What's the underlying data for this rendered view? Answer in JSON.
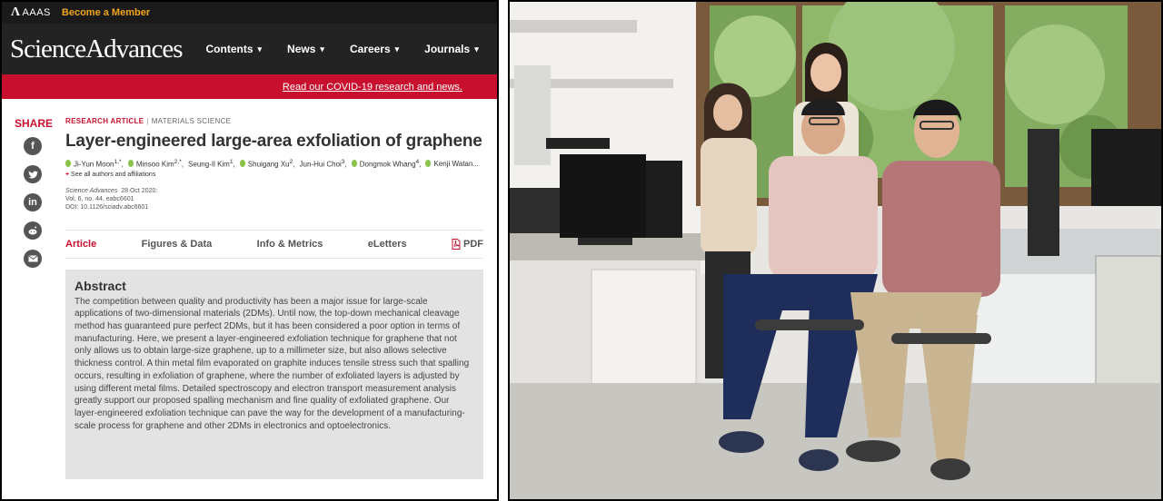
{
  "topbar": {
    "org": "AAAS",
    "become_member": "Become a Member"
  },
  "nav": {
    "brand": "ScienceAdvances",
    "items": [
      {
        "label": "Contents"
      },
      {
        "label": "News"
      },
      {
        "label": "Careers"
      },
      {
        "label": "Journals"
      }
    ]
  },
  "banner": {
    "covid_link": "Read our COVID-19 research and news."
  },
  "share": {
    "label": "SHARE",
    "icons": [
      "facebook-icon",
      "twitter-icon",
      "linkedin-icon",
      "reddit-icon",
      "email-icon"
    ]
  },
  "article": {
    "type": "RESEARCH ARTICLE",
    "subject": "MATERIALS SCIENCE",
    "title": "Layer-engineered large-area exfoliation of graphene",
    "authors": [
      {
        "name": "Ji-Yun Moon",
        "sup": "1,*"
      },
      {
        "name": "Minsoo Kim",
        "sup": "2,*"
      },
      {
        "name": "Seung-Il Kim",
        "sup": "1"
      },
      {
        "name": "Shuigang Xu",
        "sup": "2"
      },
      {
        "name": "Jun-Hui Choi",
        "sup": "3"
      },
      {
        "name": "Dongmok Whang",
        "sup": "4"
      },
      {
        "name": "Kenji Watan...",
        "sup": ""
      }
    ],
    "see_all": "See all authors and affiliations",
    "journal": "Science Advances",
    "date": "28 Oct 2020:",
    "volume": "Vol. 6, no. 44, eabc6601",
    "doi": "DOI: 10.1126/sciadv.abc6601"
  },
  "tabs": [
    {
      "label": "Article",
      "active": true
    },
    {
      "label": "Figures & Data",
      "active": false
    },
    {
      "label": "Info & Metrics",
      "active": false
    },
    {
      "label": "eLetters",
      "active": false
    },
    {
      "label": "PDF",
      "active": false
    }
  ],
  "abstract": {
    "heading": "Abstract",
    "text": "The competition between quality and productivity has been a major issue for large-scale applications of two-dimensional materials (2DMs). Until now, the top-down mechanical cleavage method has guaranteed pure perfect 2DMs, but it has been considered a poor option in terms of manufacturing. Here, we present a layer-engineered exfoliation technique for graphene that not only allows us to obtain large-size graphene, up to a millimeter size, but also allows selective thickness control. A thin metal film evaporated on graphite induces tensile stress such that spalling occurs, resulting in exfoliation of graphene, where the number of exfoliated layers is adjusted by using different metal films. Detailed spectroscopy and electron transport measurement analysis greatly support our proposed spalling mechanism and fine quality of exfoliated graphene. Our layer-engineered exfoliation technique can pave the way for the development of a manufacturing-scale process for graphene and other 2DMs in electronics and optoelectronics."
  },
  "colors": {
    "accent": "#c8102e",
    "gold": "#f2a51a",
    "header_bg": "#232323",
    "abstract_bg": "#e3e3e3"
  }
}
